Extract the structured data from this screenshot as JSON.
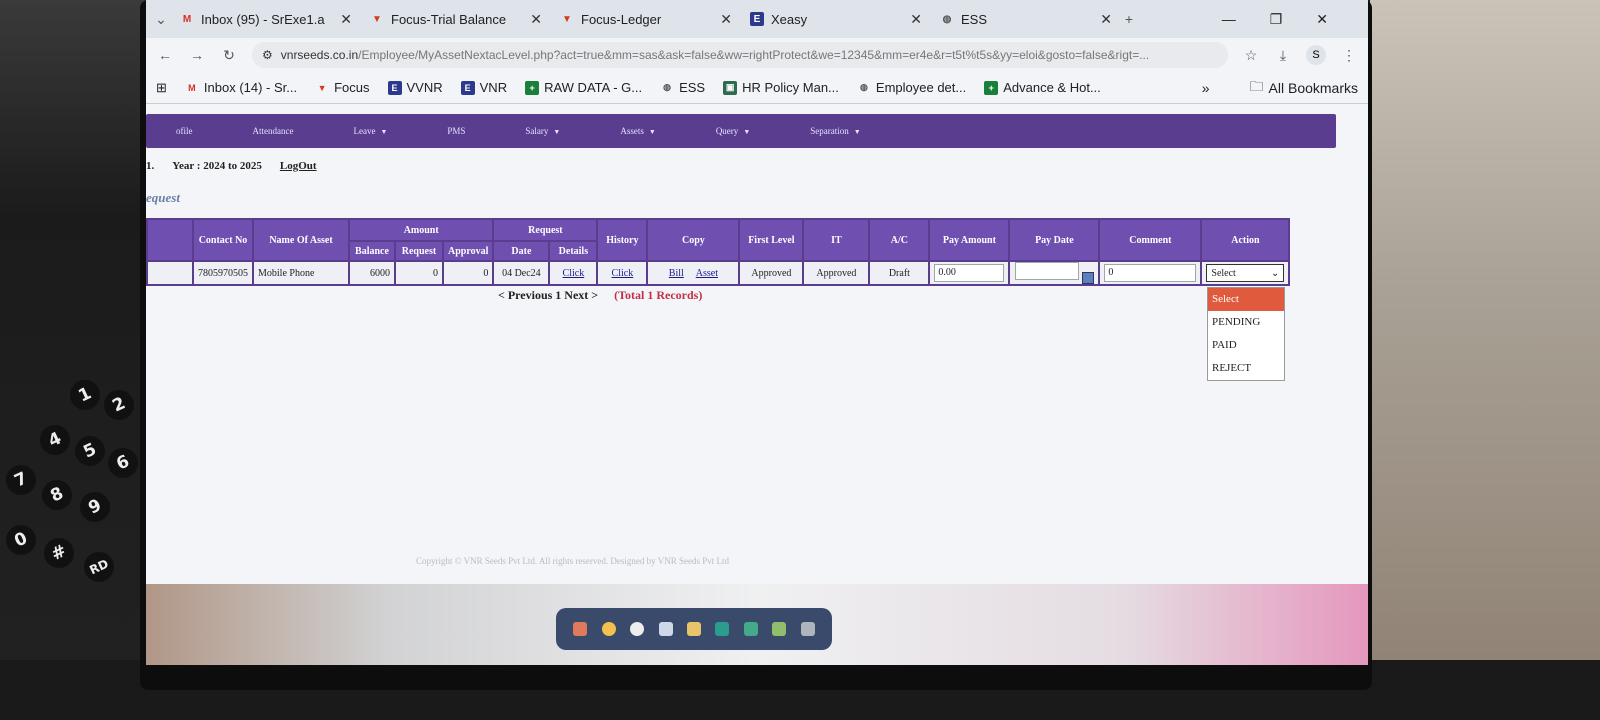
{
  "browser": {
    "tabs": [
      {
        "title": "Inbox (95) - SrExe1.a",
        "icon": "gmail-icon"
      },
      {
        "title": "Focus-Trial Balance",
        "icon": "focus-icon"
      },
      {
        "title": "Focus-Ledger",
        "icon": "focus-icon"
      },
      {
        "title": "Xeasy",
        "icon": "xeasy-icon"
      },
      {
        "title": "ESS",
        "icon": "globe-icon"
      }
    ],
    "url_domain": "vnrseeds.co.in",
    "url_path": "/Employee/MyAssetNextacLevel.php?act=true&mm=sas&ask=false&ww=rightProtect&we=12345&mm=er4e&r=t5t%t5s&yy=eloi&gosto=false&rigt=...",
    "profile_initial": "S",
    "bookmarks": [
      {
        "label": "Inbox (14) - Sr...",
        "icon": "gmail-icon"
      },
      {
        "label": "Focus",
        "icon": "focus-icon"
      },
      {
        "label": "VVNR",
        "icon": "xeasy-icon"
      },
      {
        "label": "VNR",
        "icon": "xeasy-icon"
      },
      {
        "label": "RAW DATA - G...",
        "icon": "sheets-icon"
      },
      {
        "label": "ESS",
        "icon": "globe-icon"
      },
      {
        "label": "HR Policy Man...",
        "icon": "hr-icon"
      },
      {
        "label": "Employee det...",
        "icon": "globe-icon"
      },
      {
        "label": "Advance & Hot...",
        "icon": "sheets-icon"
      }
    ],
    "bookmarks_overflow": "»",
    "all_bookmarks": "All Bookmarks"
  },
  "page": {
    "menu": [
      {
        "label": "ofile",
        "caret": false
      },
      {
        "label": "Attendance",
        "caret": false
      },
      {
        "label": "Leave",
        "caret": true
      },
      {
        "label": "PMS",
        "caret": false
      },
      {
        "label": "Salary",
        "caret": true
      },
      {
        "label": "Assets",
        "caret": true
      },
      {
        "label": "Query",
        "caret": true
      },
      {
        "label": "Separation",
        "caret": true
      }
    ],
    "year_prefix": "1.",
    "year_label": "Year : 2024 to 2025",
    "logout": "LogOut",
    "section_title": "equest",
    "table": {
      "headers": {
        "contact": "Contact No",
        "asset_name": "Name Of Asset",
        "amount": "Amount",
        "balance": "Balance",
        "request": "Request",
        "approval": "Approval",
        "request_group": "Request",
        "date": "Date",
        "details": "Details",
        "history": "History",
        "copy": "Copy",
        "first_level": "First Level",
        "it": "IT",
        "ac": "A/C",
        "pay_amount": "Pay Amount",
        "pay_date": "Pay Date",
        "comment": "Comment",
        "action": "Action"
      },
      "row": {
        "contact": "7805970505",
        "asset_name": "Mobile Phone",
        "balance": "6000",
        "request": "0",
        "approval": "0",
        "date": "04 Dec24",
        "details": "Click",
        "history": "Click",
        "bill": "Bill",
        "asset": "Asset",
        "first_level": "Approved",
        "it": "Approved",
        "ac": "Draft",
        "pay_amount": "0.00",
        "pay_date": "",
        "comment": "0",
        "action": "Select"
      }
    },
    "action_options": [
      "Select",
      "PENDING",
      "PAID",
      "REJECT"
    ],
    "pager": {
      "nav": "< Previous 1 Next >",
      "total": "(Total 1 Records)"
    },
    "footer": "Copyright © VNR Seeds Pvt Ltd. All rights reserved. Designed by  VNR Seeds Pvt Ltd"
  },
  "keypad_keys": [
    "1",
    "2",
    "4",
    "5",
    "6",
    "7",
    "8",
    "9",
    "0",
    "#",
    "RD"
  ]
}
